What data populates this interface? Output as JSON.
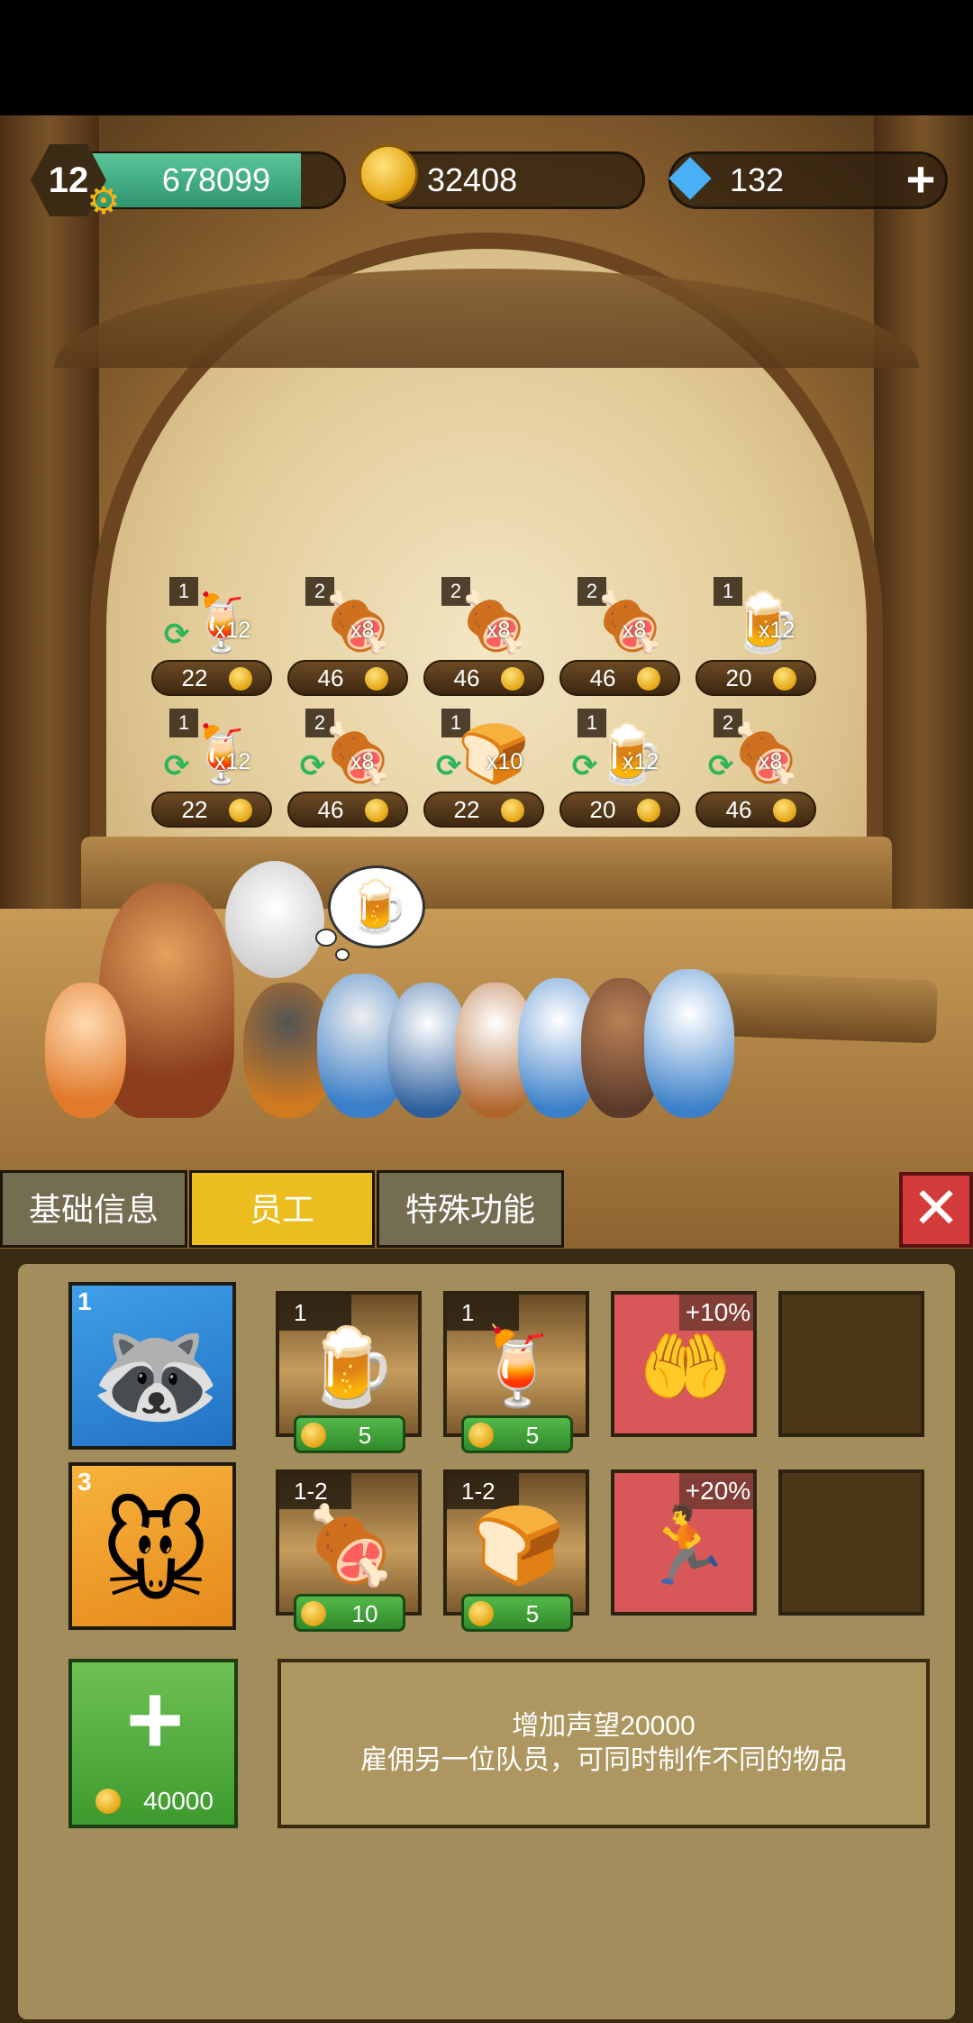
{
  "hud": {
    "level": "12",
    "reputation": "678099",
    "reputation_fill": 0.82,
    "coins": "32408",
    "gems": "132",
    "gem_plus": "+"
  },
  "orders": [
    {
      "qty": "1",
      "item": "cocktail-icon",
      "mult": "x12",
      "price": "22",
      "refresh": true
    },
    {
      "qty": "2",
      "item": "ham-icon",
      "mult": "x8",
      "price": "46",
      "refresh": false
    },
    {
      "qty": "2",
      "item": "ham-icon",
      "mult": "x8",
      "price": "46",
      "refresh": false
    },
    {
      "qty": "2",
      "item": "ham-icon",
      "mult": "x8",
      "price": "46",
      "refresh": false
    },
    {
      "qty": "1",
      "item": "beer-icon",
      "mult": "x12",
      "price": "20",
      "refresh": false
    },
    {
      "qty": "1",
      "item": "cocktail-icon",
      "mult": "x12",
      "price": "22",
      "refresh": true
    },
    {
      "qty": "2",
      "item": "ham-icon",
      "mult": "x8",
      "price": "46",
      "refresh": true
    },
    {
      "qty": "1",
      "item": "bread-icon",
      "mult": "x10",
      "price": "22",
      "refresh": true
    },
    {
      "qty": "1",
      "item": "beer-icon",
      "mult": "x12",
      "price": "20",
      "refresh": true
    },
    {
      "qty": "2",
      "item": "ham-icon",
      "mult": "x8",
      "price": "46",
      "refresh": true
    }
  ],
  "tabs": {
    "basic": "基础信息",
    "staff": "员工",
    "special": "特殊功能",
    "active": "staff"
  },
  "staff": [
    {
      "level": "1",
      "skills": [
        {
          "level": "1",
          "item": "beer-icon",
          "cost": "5"
        },
        {
          "level": "1",
          "item": "cocktail-icon",
          "cost": "5"
        }
      ],
      "boost": {
        "pct": "+10%",
        "icon": "coin-hand-icon"
      }
    },
    {
      "level": "3",
      "skills": [
        {
          "level": "1-2",
          "item": "ham-icon",
          "cost": "10"
        },
        {
          "level": "1-2",
          "item": "bread-icon",
          "cost": "5"
        }
      ],
      "boost": {
        "pct": "+20%",
        "icon": "speed-runner-icon"
      }
    }
  ],
  "hire": {
    "plus": "+",
    "cost": "40000",
    "description_line1": "增加声望20000",
    "description_line2": "雇佣另一位队员，可同时制作不同的物品"
  },
  "close_label": "✕",
  "colors": {
    "xp_bar": "#2f9670",
    "active_tab": "#ecbd1e",
    "close_button": "#d43b3b",
    "hire_button": "#4fa83c",
    "boost_tile": "#d85758"
  }
}
